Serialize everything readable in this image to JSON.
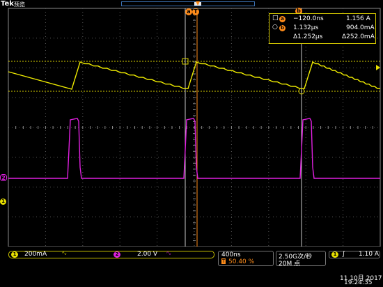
{
  "header": {
    "brand": "Tek",
    "mode": "预览",
    "trigger_marker": "T"
  },
  "cursors": {
    "a_label": "a",
    "b_label": "b"
  },
  "measurements": {
    "row_a": {
      "badge": "a",
      "time": "−120.0ns",
      "value": "1.156 A"
    },
    "row_b": {
      "badge": "b",
      "time": "1.132μs",
      "value": "904.0mA"
    },
    "row_delta": {
      "time": "Δ1.252μs",
      "value": "Δ252.0mA"
    }
  },
  "channels": {
    "ch1": {
      "number": "1",
      "scale": "200mA",
      "coupling": "ᴬᵥ",
      "color": "#e8e000"
    },
    "ch2": {
      "number": "2",
      "scale": "2.00 V",
      "coupling": "ᴬᵥ",
      "color": "#e000e0"
    }
  },
  "horizontal": {
    "timebase": "400ns",
    "position_icon": "T",
    "position": "50.40 %"
  },
  "acquisition": {
    "sample_rate": "2.50G次/秒",
    "record_length": "20M 点"
  },
  "trigger": {
    "source": "1",
    "slope": "∫",
    "level": "1.10 A"
  },
  "datetime": {
    "date": "11 10月 2017",
    "time": "19:24:35"
  }
}
